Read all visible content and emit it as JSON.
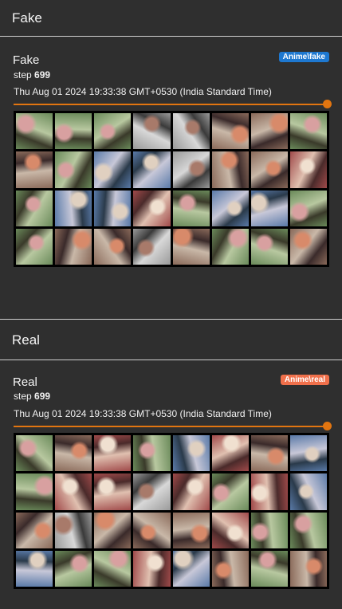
{
  "sections": [
    {
      "heading": "Fake",
      "card": {
        "name": "Fake",
        "tag": "Anime\\fake",
        "tag_color": "#1e78d0",
        "step_label": "step",
        "step_value": "699",
        "timestamp": "Thu Aug 01 2024 19:33:38 GMT+0530 (India Standard Time)",
        "slider_level": 1.0,
        "image_grid": {
          "rows": 4,
          "cols": 8
        }
      }
    },
    {
      "heading": "Real",
      "card": {
        "name": "Real",
        "tag": "Anime\\real",
        "tag_color": "#f0704b",
        "step_label": "step",
        "step_value": "699",
        "timestamp": "Thu Aug 01 2024 19:33:38 GMT+0530 (India Standard Time)",
        "slider_level": 1.0,
        "image_grid": {
          "rows": 4,
          "cols": 8
        }
      }
    }
  ],
  "colors": {
    "accent": "#e27510",
    "background": "#2f2f2f"
  }
}
